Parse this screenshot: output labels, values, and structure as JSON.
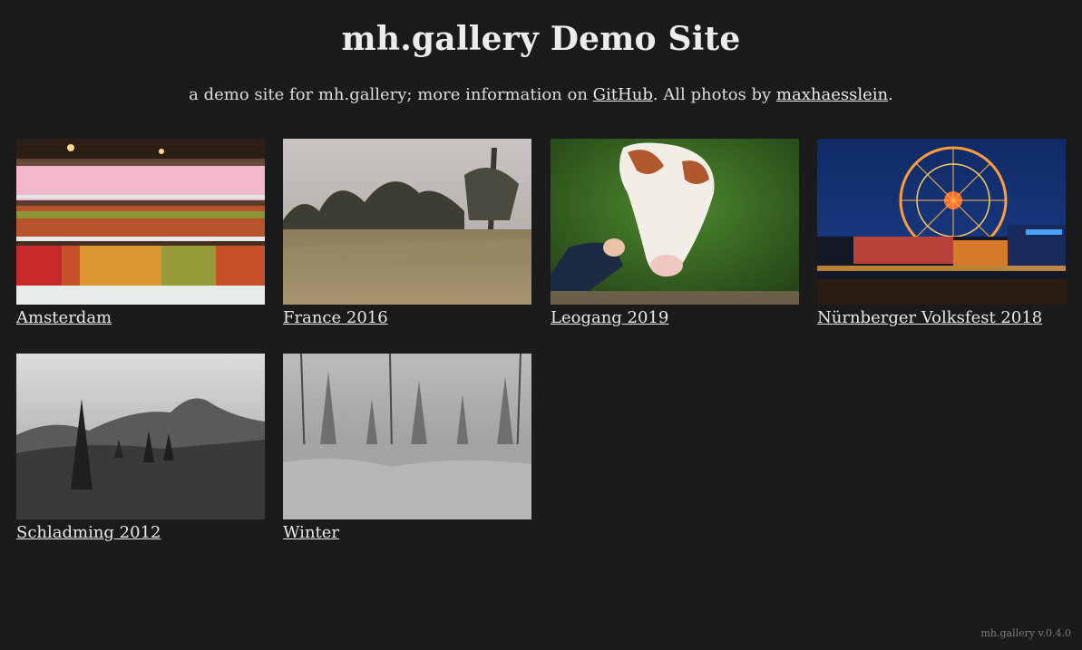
{
  "header": {
    "title": "mh.gallery Demo Site",
    "subtitle_prefix": "a demo site for mh.gallery; more information on ",
    "github_link": "GitHub",
    "subtitle_middle": ". All photos by ",
    "author_link": "maxhaesslein",
    "subtitle_suffix": "."
  },
  "galleries": [
    {
      "title": "Amsterdam"
    },
    {
      "title": "France 2016"
    },
    {
      "title": "Leogang 2019"
    },
    {
      "title": "Nürnberger Volksfest 2018"
    },
    {
      "title": "Schladming 2012"
    },
    {
      "title": "Winter"
    }
  ],
  "footer": {
    "version": "mh.gallery v.0.4.0"
  },
  "colors": {
    "background": "#1b1b1b",
    "text": "#e8e8e8",
    "footer_text": "#7a7a7a"
  }
}
